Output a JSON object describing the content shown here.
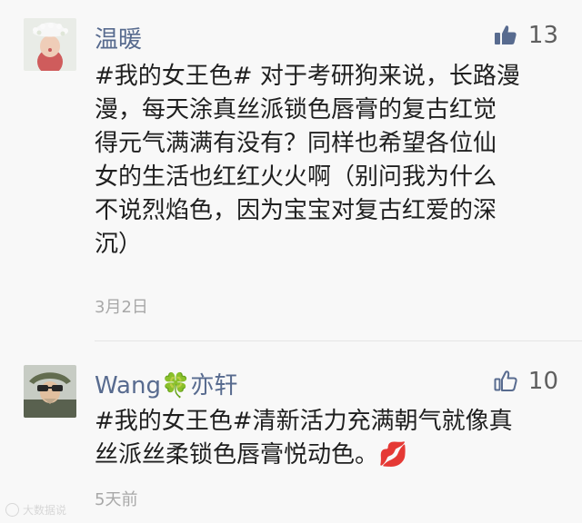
{
  "comments": [
    {
      "author": "温暖",
      "likes": "13",
      "lines": [
        "#我的女王色# 对于考研狗来说，长路漫",
        "漫，每天涂真丝派锁色唇膏的复古红觉",
        "得元气满满有没有？同样也希望各位仙",
        "女的生活也红红火火啊（别问我为什么",
        "不说烈焰色，因为宝宝对复古红爱的深",
        "沉）"
      ],
      "date": "3月2日",
      "like_icon": "thumbs-up-filled-icon"
    },
    {
      "author_prefix": "Wang",
      "author_emoji": "🍀",
      "author_suffix": "亦轩",
      "likes": "10",
      "lines": [
        "#我的女王色#清新活力充满朝气就像真",
        "丝派丝柔锁色唇膏悦动色。💋"
      ],
      "date": "5天前",
      "like_icon": "thumbs-up-outline-icon"
    }
  ],
  "watermark": "大数据说"
}
